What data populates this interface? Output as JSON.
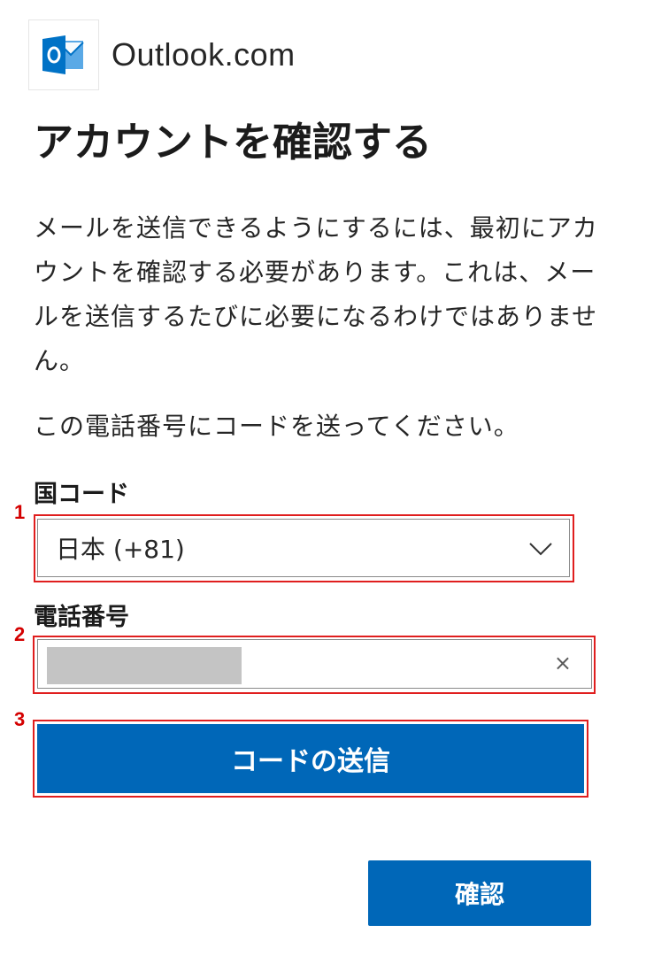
{
  "brand": {
    "name": "Outlook.com",
    "logo_icon": "outlook-logo-icon",
    "logo_color": "#0072c6"
  },
  "page": {
    "title": "アカウントを確認する",
    "description": "メールを送信できるようにするには、最初にアカウントを確認する必要があります。これは、メールを送信するたびに必要になるわけではありません。",
    "instruction": "この電話番号にコードを送ってください。"
  },
  "country_code": {
    "label": "国コード",
    "selected": "日本 (+81)",
    "dropdown_icon": "chevron-down-icon"
  },
  "phone_number": {
    "label": "電話番号",
    "value_masked": true,
    "clear_icon": "close-icon",
    "clear_glyph": "×"
  },
  "buttons": {
    "send_code": "コードの送信",
    "confirm": "確認"
  },
  "annotations": {
    "step_1": "1",
    "step_2": "2",
    "step_3": "3",
    "highlight_color": "#e01e1e"
  },
  "colors": {
    "primary_button": "#0067b8",
    "text": "#1b1b1b"
  }
}
